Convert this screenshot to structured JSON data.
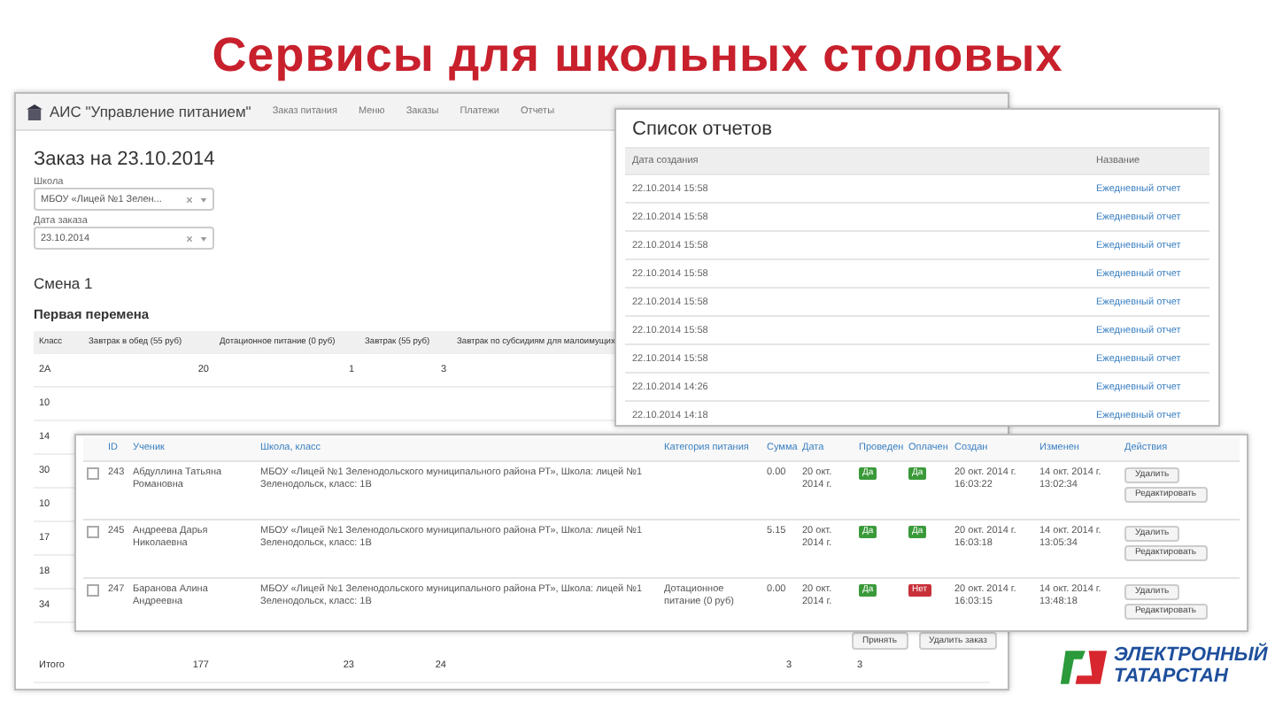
{
  "slide_title": "Сервисы для школьных столовых",
  "order_window": {
    "app_title": "АИС \"Управление питанием\"",
    "menu": [
      "Заказ питания",
      "Меню",
      "Заказы",
      "Платежи",
      "Отчеты"
    ],
    "title": "Заказ на 23.10.2014",
    "fields": [
      {
        "label": "Школа",
        "value": "МБОУ «Лицей №1 Зелен..."
      },
      {
        "label": "Дата заказа",
        "value": "23.10.2014"
      }
    ],
    "shift": "Смена 1",
    "break": "Первая перемена",
    "columns": [
      "Класс",
      "Завтрак в обед (55 руб)",
      "Дотационное питание (0 руб)",
      "Завтрак (55 руб)",
      "Завтрак по субсидиям для малоимущих"
    ],
    "rows": [
      {
        "class": "2А",
        "values": [
          "20",
          "1",
          "3"
        ]
      },
      {
        "class": "10"
      },
      {
        "class": "14"
      },
      {
        "class": "30"
      },
      {
        "class": "10"
      },
      {
        "class": "17"
      },
      {
        "class": "18"
      },
      {
        "class": "34"
      }
    ],
    "buttons": [
      "Принять",
      "Удалить заказ"
    ],
    "total": {
      "label": "Итого",
      "values": [
        "177",
        "23",
        "24"
      ],
      "extra_values": [
        "3",
        "3"
      ]
    }
  },
  "reports_window": {
    "title": "Список отчетов",
    "columns": [
      "Дата создания",
      "Название"
    ],
    "rows": [
      {
        "date": "22.10.2014 15:58",
        "name": "Ежедневный отчет"
      },
      {
        "date": "22.10.2014 15:58",
        "name": "Ежедневный отчет"
      },
      {
        "date": "22.10.2014 15:58",
        "name": "Ежедневный отчет"
      },
      {
        "date": "22.10.2014 15:58",
        "name": "Ежедневный отчет"
      },
      {
        "date": "22.10.2014 15:58",
        "name": "Ежедневный отчет"
      },
      {
        "date": "22.10.2014 15:58",
        "name": "Ежедневный отчет"
      },
      {
        "date": "22.10.2014 15:58",
        "name": "Ежедневный отчет"
      },
      {
        "date": "22.10.2014 14:26",
        "name": "Ежедневный отчет"
      },
      {
        "date": "22.10.2014 14:18",
        "name": "Ежедневный отчет"
      }
    ]
  },
  "payments_window": {
    "columns": [
      "ID",
      "Ученик",
      "Школа, класс",
      "Категория питания",
      "Сумма",
      "Дата",
      "Проведен",
      "Оплачен",
      "Создан",
      "Изменен",
      "Действия"
    ],
    "rows": [
      {
        "checked": false,
        "id": "243",
        "student": "Абдуллина Татьяна Романовна",
        "school": "МБОУ «Лицей №1 Зеленодольского муниципального района РТ», Школа: лицей №1 Зеленодольск, класс: 1В",
        "sum": "0.00",
        "date": "20 окт. 2014 г.",
        "posted": {
          "on": true,
          "text": "Да"
        },
        "paid": {
          "on": true,
          "text": "Да"
        },
        "created": "20 окт. 2014 г. 16:03:22",
        "changed": "14 окт. 2014 г. 13:02:34",
        "actions": [
          "Удалить",
          "Редактировать"
        ]
      },
      {
        "checked": false,
        "id": "245",
        "student": "Андреева Дарья Николаевна",
        "school": "МБОУ «Лицей №1 Зеленодольского муниципального района РТ», Школа: лицей №1 Зеленодольск, класс: 1В",
        "sum": "5.15",
        "date": "20 окт. 2014 г.",
        "posted": {
          "on": true,
          "text": "Да"
        },
        "paid": {
          "on": true,
          "text": "Да"
        },
        "created": "20 окт. 2014 г. 16:03:18",
        "changed": "14 окт. 2014 г. 13:05:34",
        "actions": [
          "Удалить",
          "Редактировать"
        ]
      },
      {
        "checked": false,
        "id": "247",
        "student": "Баранова Алина Андреевна",
        "school": "МБОУ «Лицей №1 Зеленодольского муниципального района РТ», Школа: лицей №1 Зеленодольск, класс: 1В",
        "category": "Дотационное питание (0 руб)",
        "sum": "0.00",
        "date": "20 окт. 2014 г.",
        "posted": {
          "on": true,
          "text": "Да"
        },
        "paid": {
          "on": false,
          "text": "Нет"
        },
        "created": "20 окт. 2014 г. 16:03:15",
        "changed": "14 окт. 2014 г. 13:48:18",
        "actions": [
          "Удалить",
          "Редактировать"
        ]
      }
    ]
  },
  "logo": {
    "line_1": "ЭЛЕКТРОННЫЙ",
    "line_2": "ТАТАРСТАН"
  }
}
